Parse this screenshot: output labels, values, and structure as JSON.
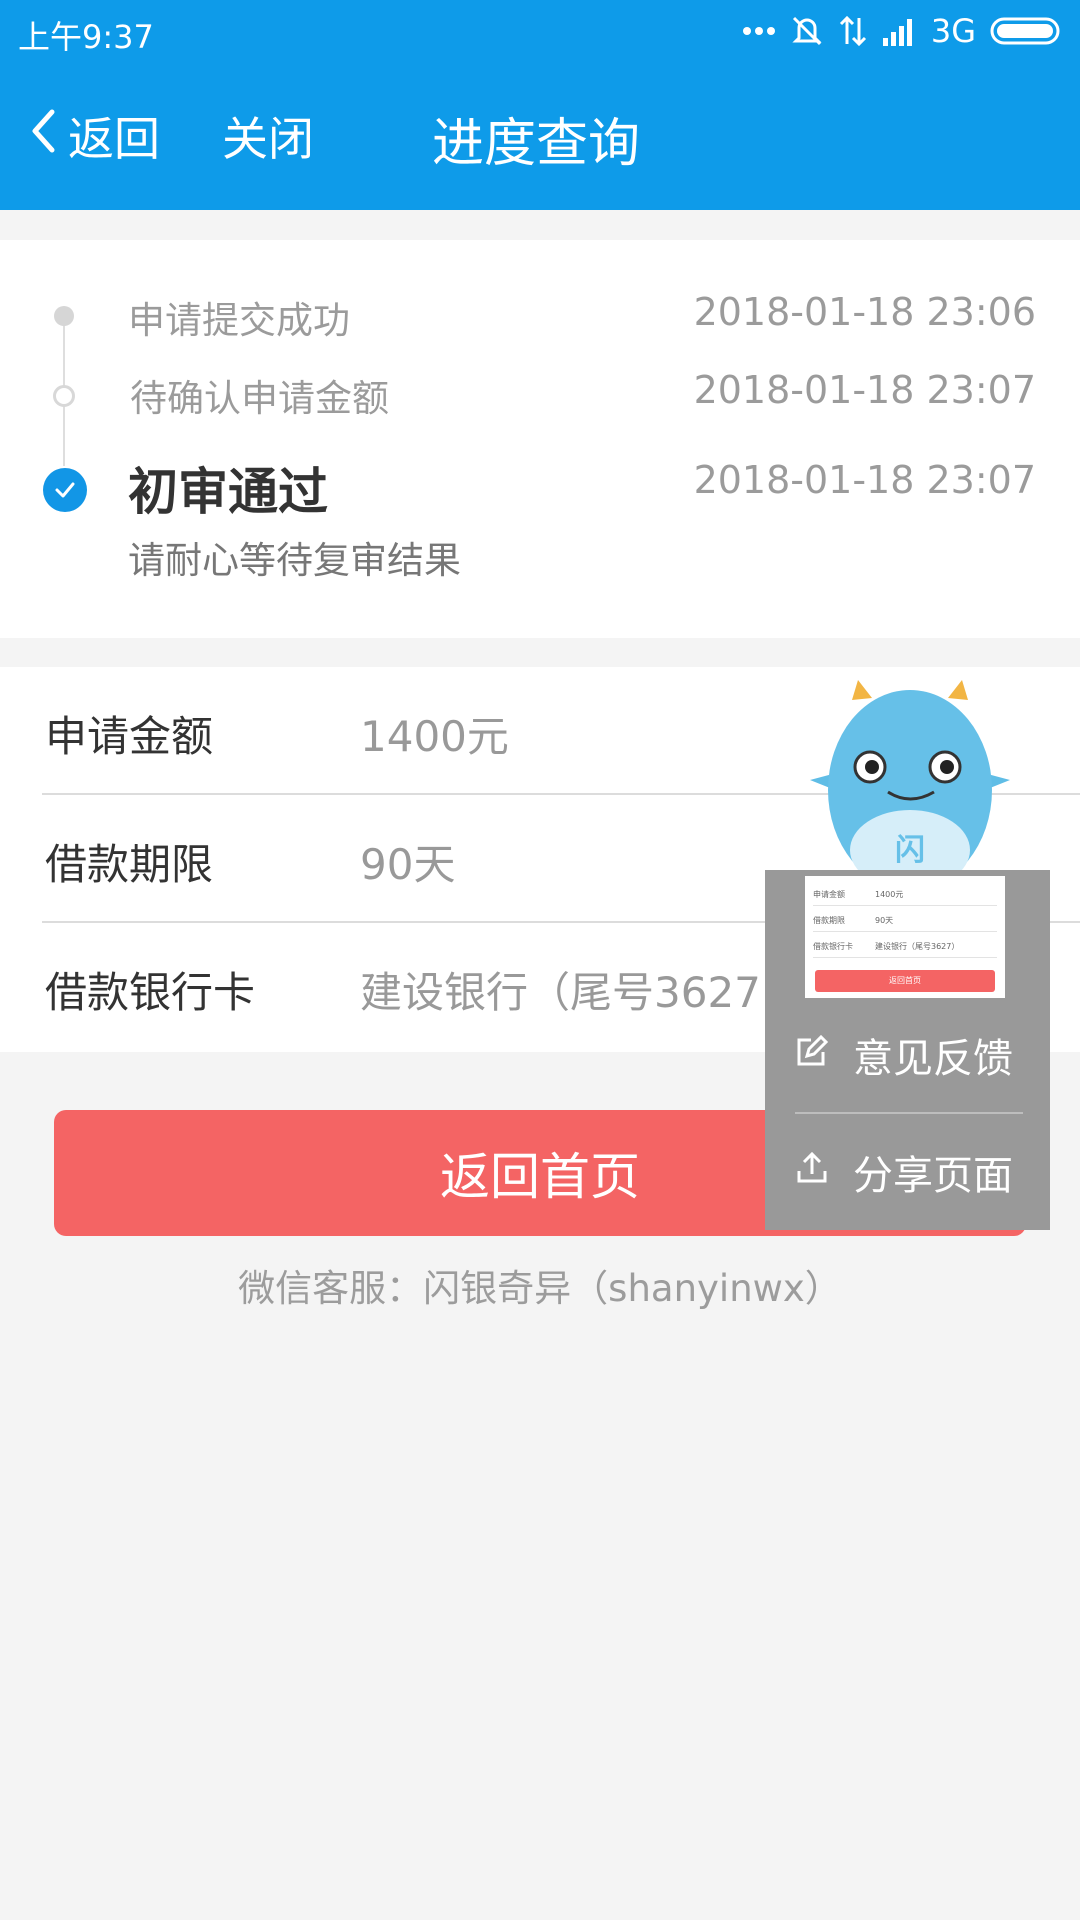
{
  "status_bar": {
    "time": "上午9:37",
    "network": "3G"
  },
  "header": {
    "back_label": "返回",
    "close_label": "关闭",
    "title": "进度查询"
  },
  "progress": {
    "steps": [
      {
        "label": "申请提交成功",
        "time": "2018-01-18 23:06"
      },
      {
        "label": "待确认申请金额",
        "time": "2018-01-18 23:07"
      },
      {
        "label": "初审通过",
        "time": "2018-01-18 23:07"
      }
    ],
    "note": "请耐心等待复审结果"
  },
  "info": {
    "rows": [
      {
        "label": "申请金额",
        "value": "1400元"
      },
      {
        "label": "借款期限",
        "value": "90天"
      },
      {
        "label": "借款银行卡",
        "value": "建设银行（尾号3627"
      }
    ]
  },
  "actions": {
    "home_button": "返回首页"
  },
  "footer": {
    "service": "微信客服：闪银奇异（shanyinwx）"
  },
  "popup": {
    "thumbnail": {
      "rows": [
        {
          "label": "申请金额",
          "value": "1400元"
        },
        {
          "label": "借款期限",
          "value": "90天"
        },
        {
          "label": "借款银行卡",
          "value": "建设银行（尾号3627）"
        }
      ],
      "button": "返回首页"
    },
    "feedback_label": "意见反馈",
    "share_label": "分享页面",
    "mascot_badge": "闪"
  },
  "colors": {
    "primary": "#0e9be9",
    "button": "#f46464",
    "check": "#1296e6",
    "overlay": "#999999"
  }
}
